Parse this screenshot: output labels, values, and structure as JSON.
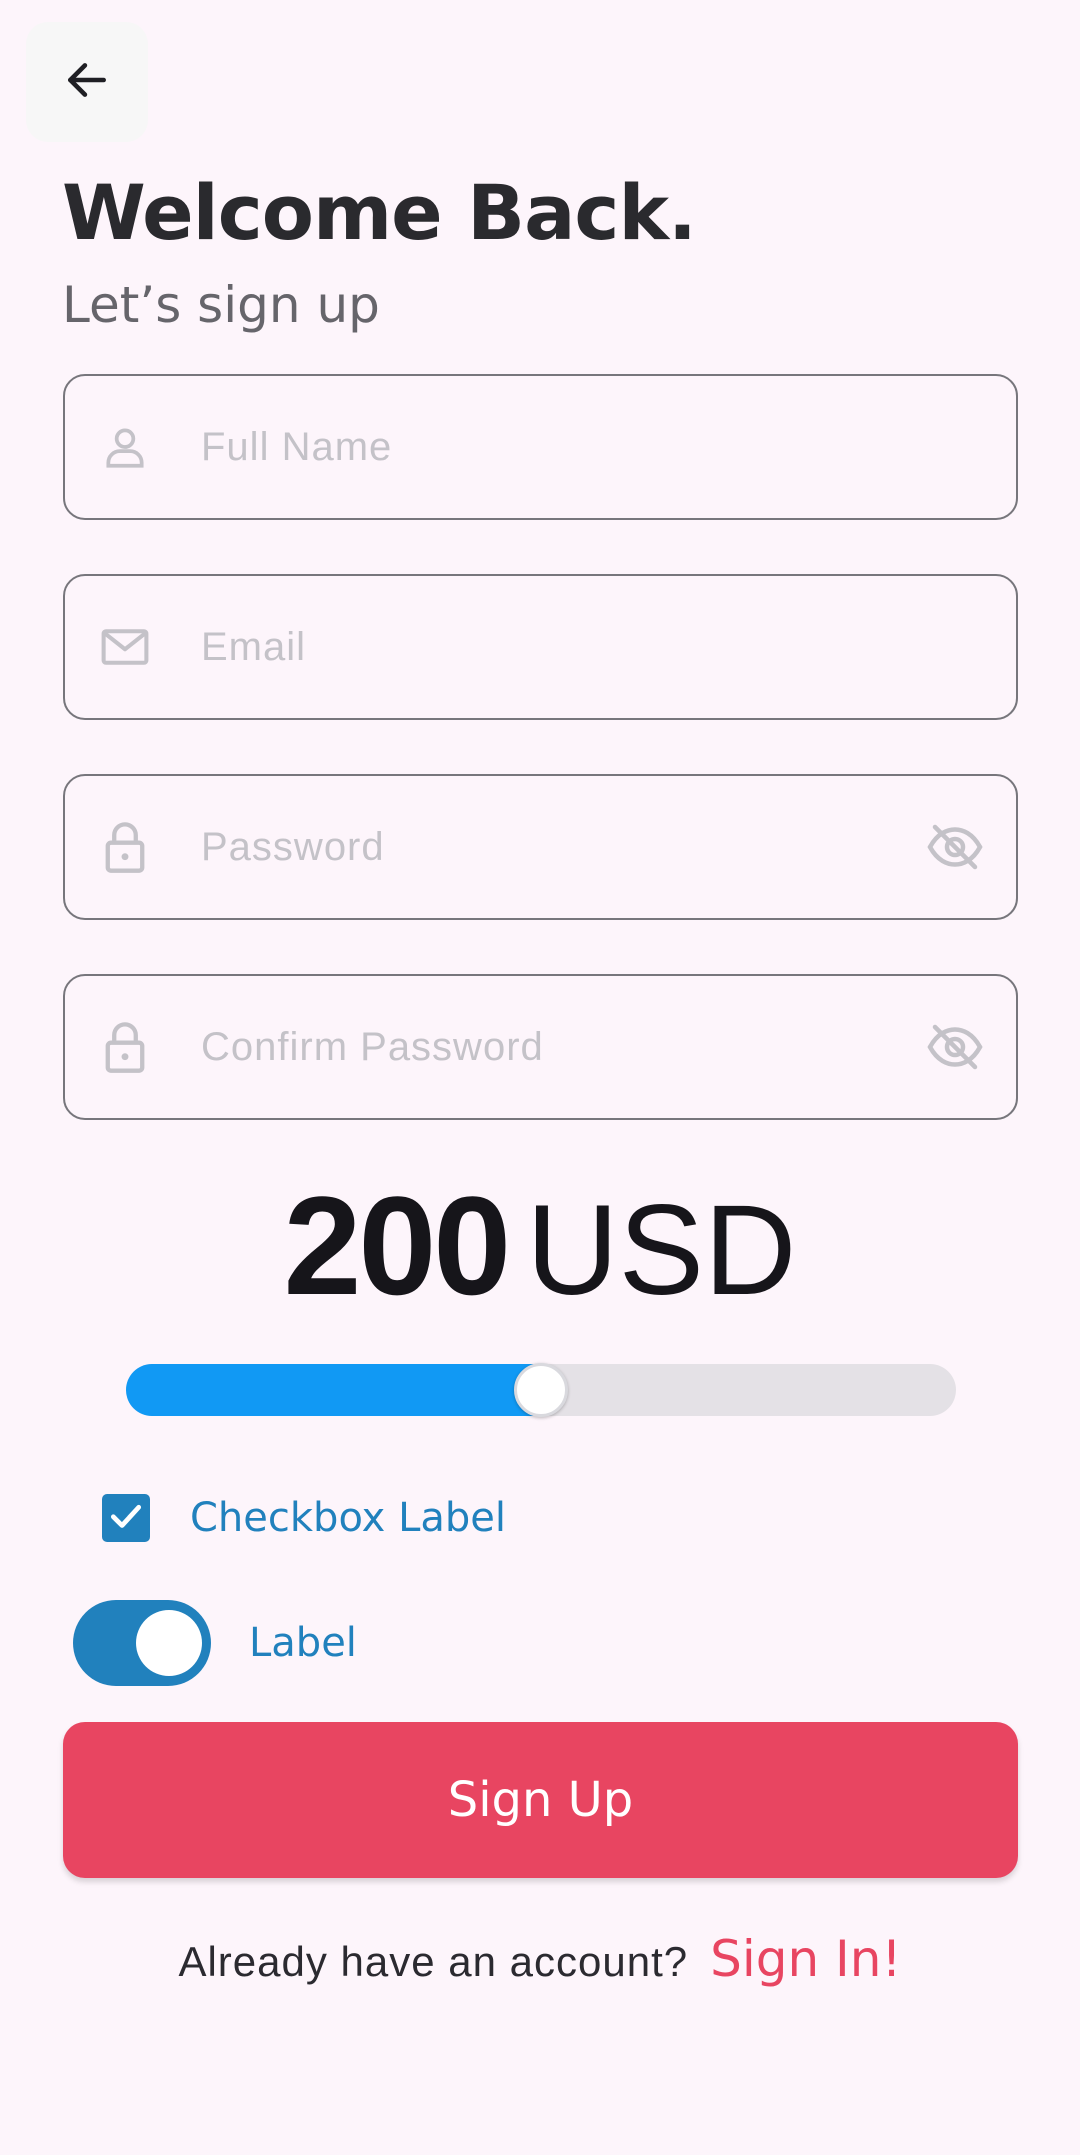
{
  "header": {
    "back_icon": "arrow-left-icon",
    "title": "Welcome Back.",
    "subtitle": "Let’s sign up"
  },
  "form": {
    "full_name": {
      "placeholder": "Full Name",
      "value": "",
      "icon": "person-icon"
    },
    "email": {
      "placeholder": "Email",
      "value": "",
      "icon": "mail-icon"
    },
    "password": {
      "placeholder": "Password",
      "value": "",
      "icon": "lock-icon",
      "toggle_icon": "eye-off-icon"
    },
    "confirm_password": {
      "placeholder": "Confirm Password",
      "value": "",
      "icon": "lock-icon",
      "toggle_icon": "eye-off-icon"
    }
  },
  "amount": {
    "value": "200",
    "currency": "USD",
    "slider_fraction": 0.5
  },
  "checkbox": {
    "label": "Checkbox Label",
    "checked": true
  },
  "switch": {
    "label": "Label",
    "on": true
  },
  "actions": {
    "signup_label": "Sign Up",
    "footer_question": "Already have an account?",
    "signin_label": "Sign In!"
  },
  "colors": {
    "background": "#fdf5fb",
    "accent_blue": "#2181bd",
    "slider_blue": "#1199f4",
    "primary_red": "#e84561"
  }
}
